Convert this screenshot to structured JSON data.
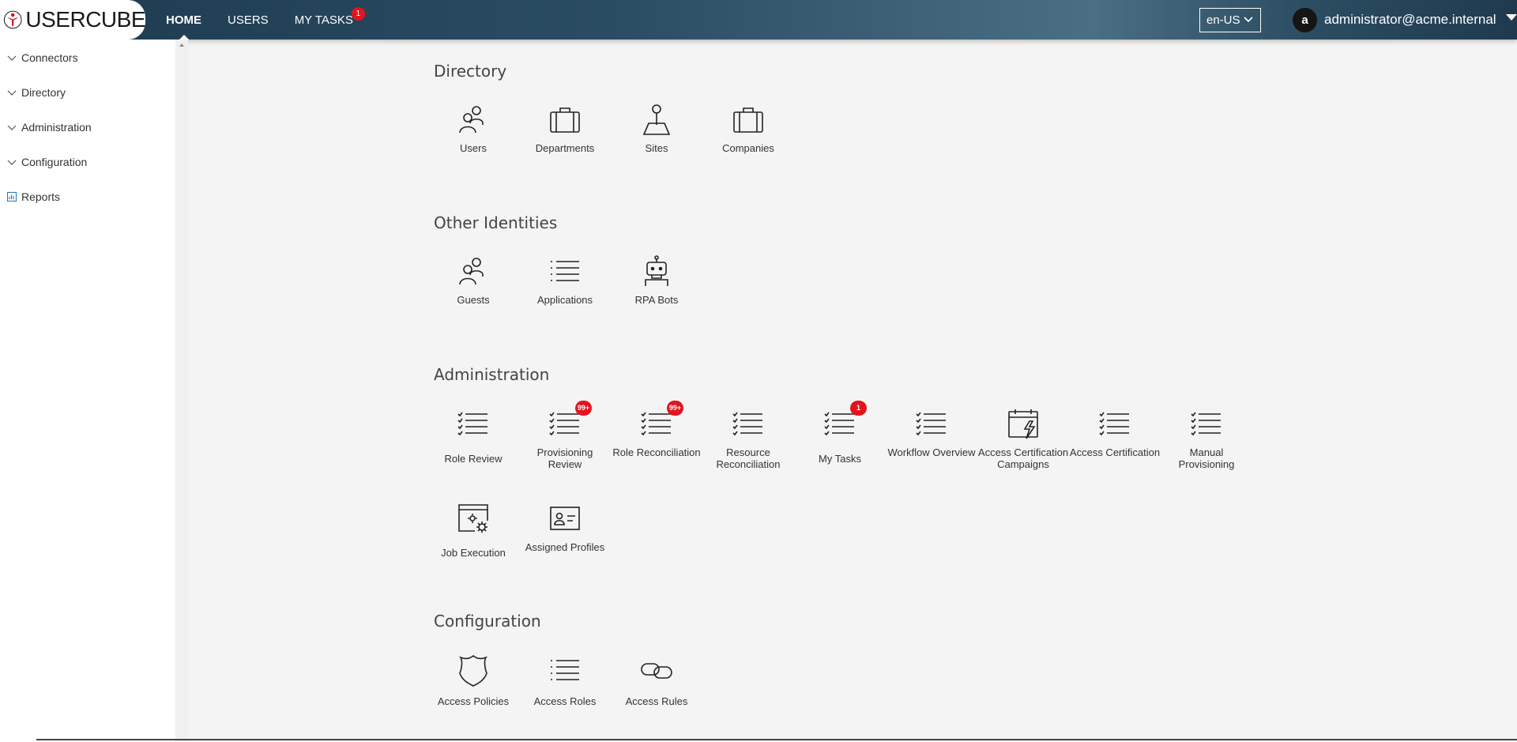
{
  "brand": {
    "name": "USERCUBE",
    "logo_color": "#d0111b"
  },
  "nav": {
    "items": [
      {
        "label": "HOME",
        "active": true
      },
      {
        "label": "USERS",
        "active": false
      },
      {
        "label": "MY TASKS",
        "active": false,
        "badge": "1"
      }
    ]
  },
  "header": {
    "language": "en-US",
    "user": {
      "initial": "a",
      "name": "administrator@acme.internal"
    }
  },
  "sidebar": {
    "items": [
      {
        "label": "Connectors",
        "icon": "chevron-down-icon"
      },
      {
        "label": "Directory",
        "icon": "chevron-down-icon"
      },
      {
        "label": "Administration",
        "icon": "chevron-down-icon"
      },
      {
        "label": "Configuration",
        "icon": "chevron-down-icon"
      },
      {
        "label": "Reports",
        "icon": "report-icon"
      }
    ]
  },
  "sections": {
    "directory": {
      "title": "Directory",
      "tiles": [
        {
          "label": "Users",
          "icon": "users-icon"
        },
        {
          "label": "Departments",
          "icon": "briefcase-icon"
        },
        {
          "label": "Sites",
          "icon": "map-pin-icon"
        },
        {
          "label": "Companies",
          "icon": "briefcase-icon"
        }
      ]
    },
    "other_identities": {
      "title": "Other Identities",
      "tiles": [
        {
          "label": "Guests",
          "icon": "users-icon"
        },
        {
          "label": "Applications",
          "icon": "list-icon"
        },
        {
          "label": "RPA Bots",
          "icon": "robot-icon"
        }
      ]
    },
    "administration": {
      "title": "Administration",
      "tiles": [
        {
          "label": "Role Review",
          "icon": "checklist-icon"
        },
        {
          "label": "Provisioning Review",
          "icon": "checklist-icon",
          "badge": "99+"
        },
        {
          "label": "Role Reconciliation",
          "icon": "checklist-icon",
          "badge": "99+"
        },
        {
          "label": "Resource Reconciliation",
          "icon": "checklist-icon"
        },
        {
          "label": "My Tasks",
          "icon": "checklist-icon",
          "badge": "1"
        },
        {
          "label": "Workflow Overview",
          "icon": "checklist-icon"
        },
        {
          "label": "Access Certification Campaigns",
          "icon": "calendar-bolt-icon"
        },
        {
          "label": "Access Certification",
          "icon": "checklist-icon"
        },
        {
          "label": "Manual Provisioning",
          "icon": "checklist-icon"
        },
        {
          "label": "Job Execution",
          "icon": "window-gears-icon"
        },
        {
          "label": "Assigned Profiles",
          "icon": "id-card-icon"
        }
      ]
    },
    "configuration": {
      "title": "Configuration",
      "tiles": [
        {
          "label": "Access Policies",
          "icon": "shield-icon"
        },
        {
          "label": "Access Roles",
          "icon": "list-icon"
        },
        {
          "label": "Access Rules",
          "icon": "link-icon"
        }
      ]
    }
  },
  "colors": {
    "header_dark": "#1d3a4f",
    "header_light": "#4a6e82",
    "badge": "#e3141f",
    "background": "#f4f4f4"
  }
}
